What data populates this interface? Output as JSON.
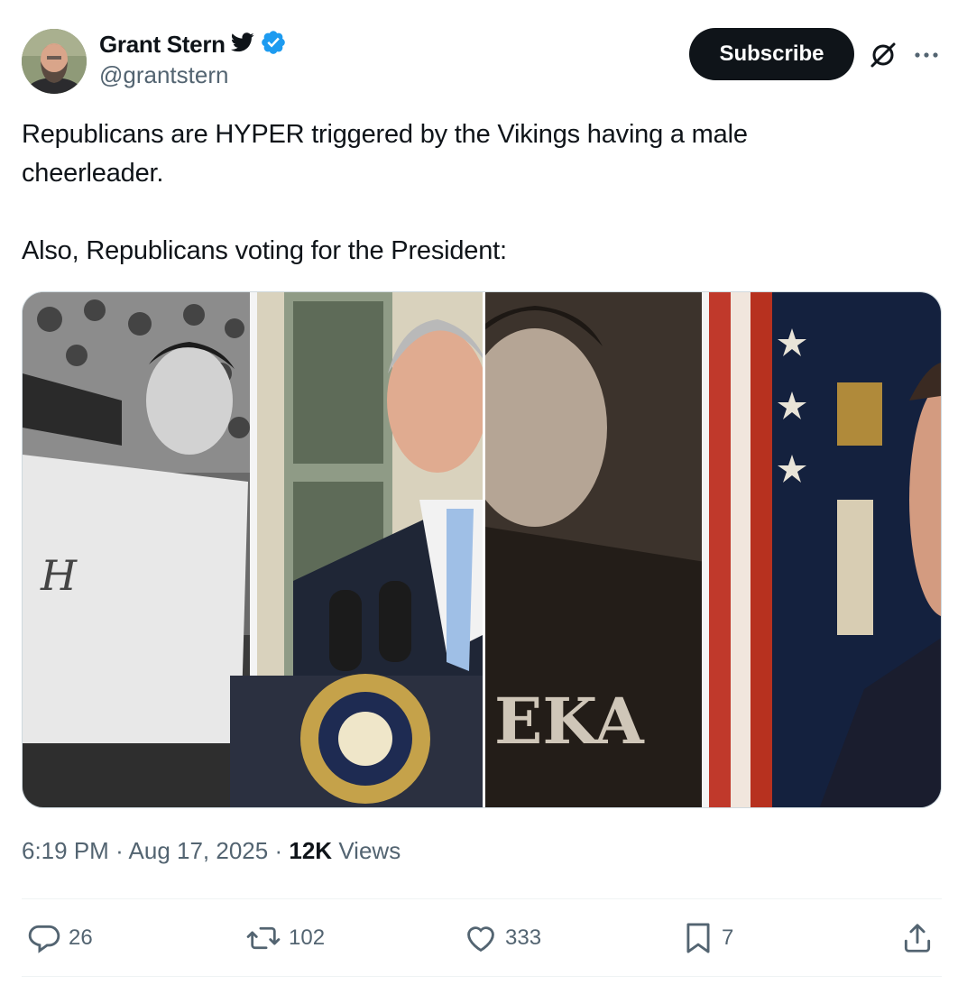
{
  "author": {
    "display_name": "Grant Stern",
    "handle": "@grantstern",
    "verified": true,
    "badge_icon": "twitter-bird-icon",
    "verified_icon": "verified-badge-icon",
    "verified_color": "#1d9bf0"
  },
  "header": {
    "subscribe_label": "Subscribe",
    "grok_icon": "grok-icon",
    "more_icon": "more-icon"
  },
  "tweet": {
    "line1": "Republicans are HYPER triggered by the Vikings having a male cheerleader.",
    "line2": "Also, Republicans voting for the President:"
  },
  "media": [
    {
      "description_icon": "photo-left-collage"
    },
    {
      "description_icon": "photo-right-collage"
    }
  ],
  "meta": {
    "time": "6:19 PM",
    "separator": "·",
    "date": "Aug 17, 2025",
    "views_count": "12K",
    "views_label": "Views"
  },
  "actions": {
    "replies": "26",
    "reposts": "102",
    "likes": "333",
    "bookmarks": "7"
  },
  "colors": {
    "text_primary": "#0f1419",
    "text_secondary": "#536471",
    "divider": "#eff3f4"
  }
}
